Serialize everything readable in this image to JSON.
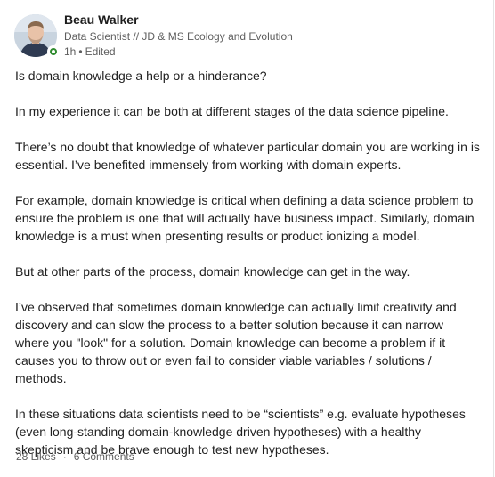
{
  "post": {
    "author": {
      "name": "Beau Walker",
      "headline": "Data Scientist // JD & MS Ecology and Evolution",
      "time": "1h",
      "edited": "Edited",
      "separator": "•",
      "status_color": "#2e8b2e"
    },
    "paragraphs": [
      "Is domain knowledge a help or a hinderance?",
      "In my experience it can be both at different stages of the data science pipeline.",
      "There’s no doubt that knowledge of whatever particular domain you are working in is essential. I’ve benefited immensely from working with domain experts.",
      "For example, domain knowledge is critical when defining a data science problem to ensure the problem is one that will actually have business impact. Similarly, domain knowledge is a must when presenting results or product ionizing a model.",
      "But at other parts of the process, domain knowledge can get in the way.",
      "I’ve observed that sometimes domain knowledge can actually limit creativity and discovery and can slow the process to a better solution because it can narrow where you \"look\" for a solution. Domain knowledge can become a problem if it causes you to throw out or even fail to consider viable variables / solutions / methods.",
      "In these situations data scientists need to be “scientists” e.g. evaluate hypotheses (even long-standing domain-knowledge driven hypotheses) with a healthy skepticism and be brave enough to test new hypotheses."
    ],
    "social": {
      "likes": "28 Likes",
      "comments": "6 Comments",
      "separator": "·"
    }
  }
}
